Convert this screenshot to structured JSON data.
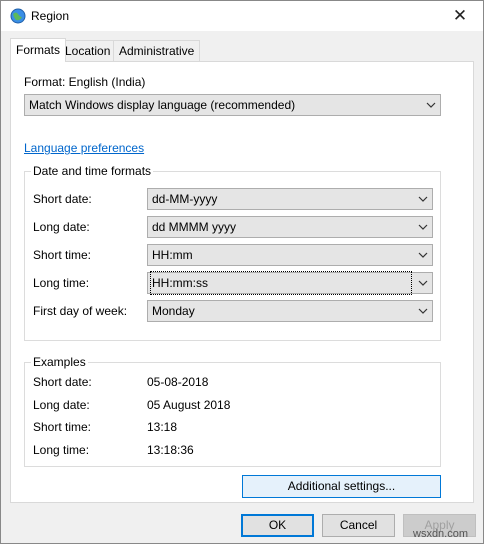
{
  "window": {
    "title": "Region",
    "icon": "globe-icon",
    "close_glyph": "✕"
  },
  "tabs": [
    {
      "label": "Formats",
      "active": true
    },
    {
      "label": "Location",
      "active": false
    },
    {
      "label": "Administrative",
      "active": false
    }
  ],
  "format": {
    "label": "Format: English (India)",
    "selected": "Match Windows display language (recommended)"
  },
  "language_preferences_link": "Language preferences",
  "date_time_formats": {
    "title": "Date and time formats",
    "rows": [
      {
        "label": "Short date:",
        "value": "dd-MM-yyyy"
      },
      {
        "label": "Long date:",
        "value": "dd MMMM yyyy"
      },
      {
        "label": "Short time:",
        "value": "HH:mm"
      },
      {
        "label": "Long time:",
        "value": "HH:mm:ss"
      },
      {
        "label": "First day of week:",
        "value": "Monday"
      }
    ]
  },
  "examples": {
    "title": "Examples",
    "rows": [
      {
        "label": "Short date:",
        "value": "05-08-2018"
      },
      {
        "label": "Long date:",
        "value": "05 August 2018"
      },
      {
        "label": "Short time:",
        "value": "13:18"
      },
      {
        "label": "Long time:",
        "value": "13:18:36"
      }
    ]
  },
  "additional_settings_button": "Additional settings...",
  "footer": {
    "ok": "OK",
    "cancel": "Cancel",
    "apply": "Apply"
  },
  "watermark": "wsxdn.com",
  "colors": {
    "accent": "#0078d7",
    "link": "#0066cc"
  }
}
